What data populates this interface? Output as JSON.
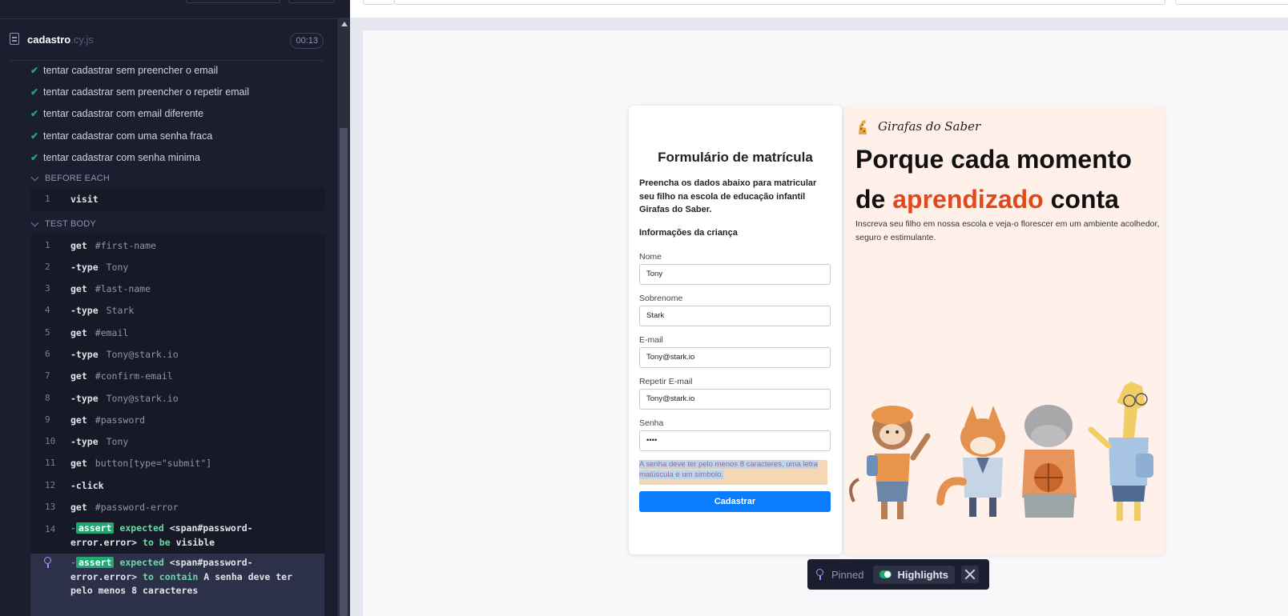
{
  "spec": {
    "name": "cadastro",
    "ext": ".cy.js",
    "duration": "00:13"
  },
  "tests": [
    "tentar cadastrar sem preencher o email",
    "tentar cadastrar sem preencher o repetir email",
    "tentar cadastrar com email diferente",
    "tentar cadastrar com uma senha fraca",
    "tentar cadastrar com senha minima"
  ],
  "before_each": {
    "header": "BEFORE EACH",
    "commands": [
      {
        "num": "1",
        "name": "visit",
        "msg": ""
      }
    ]
  },
  "test_body": {
    "header": "TEST BODY",
    "commands": [
      {
        "num": "1",
        "name": "get",
        "msg": "#first-name"
      },
      {
        "num": "2",
        "name": "-type",
        "msg": "Tony"
      },
      {
        "num": "3",
        "name": "get",
        "msg": "#last-name"
      },
      {
        "num": "4",
        "name": "-type",
        "msg": "Stark"
      },
      {
        "num": "5",
        "name": "get",
        "msg": "#email"
      },
      {
        "num": "6",
        "name": "-type",
        "msg": "Tony@stark.io"
      },
      {
        "num": "7",
        "name": "get",
        "msg": "#confirm-email"
      },
      {
        "num": "8",
        "name": "-type",
        "msg": "Tony@stark.io"
      },
      {
        "num": "9",
        "name": "get",
        "msg": "#password"
      },
      {
        "num": "10",
        "name": "-type",
        "msg": "Tony"
      },
      {
        "num": "11",
        "name": "get",
        "msg": "button[type=\"submit\"]"
      },
      {
        "num": "12",
        "name": "-click",
        "msg": ""
      },
      {
        "num": "13",
        "name": "get",
        "msg": "#password-error"
      }
    ],
    "assert1": {
      "num": "14",
      "badge": "assert",
      "expected": "expected",
      "subject": "<span#password-",
      "subject2": "error.error>",
      "to_be": "to be",
      "visible": "visible"
    },
    "assert2": {
      "badge": "assert",
      "expected": "expected",
      "subject": "<span#password-",
      "subject2": "error.error>",
      "to_contain": "to contain",
      "text1": "A senha deve ter",
      "text2": "pelo menos 8 caracteres"
    }
  },
  "form": {
    "title": "Formulário de matrícula",
    "description": "Preencha os dados abaixo para matricular seu filho na escola de educação infantil Girafas do Saber.",
    "section": "Informações da criança",
    "fields": [
      {
        "label": "Nome",
        "value": "Tony"
      },
      {
        "label": "Sobrenome",
        "value": "Stark"
      },
      {
        "label": "E-mail",
        "value": "Tony@stark.io"
      },
      {
        "label": "Repetir E-mail",
        "value": "Tony@stark.io"
      },
      {
        "label": "Senha",
        "value": "••••"
      }
    ],
    "password_error": "A senha deve ter pelo menos 8 caracteres, uma letra maiúscula e um símbolo.",
    "submit": "Cadastrar"
  },
  "hero": {
    "brand": "Girafas do Saber",
    "title_a": "Porque cada momento",
    "title_b": "de",
    "title_accent": "aprendizado",
    "title_c": "conta",
    "subtitle": "Inscreva seu filho em nossa escola e veja-o florescer em um ambiente acolhedor, seguro e estimulante."
  },
  "pin_bar": {
    "pinned": "Pinned",
    "highlights": "Highlights"
  },
  "colors": {
    "accent": "#e2481a",
    "pass_green": "#1fa971",
    "primary_button": "#0a7cff",
    "pin_purple": "#b58cf5"
  }
}
